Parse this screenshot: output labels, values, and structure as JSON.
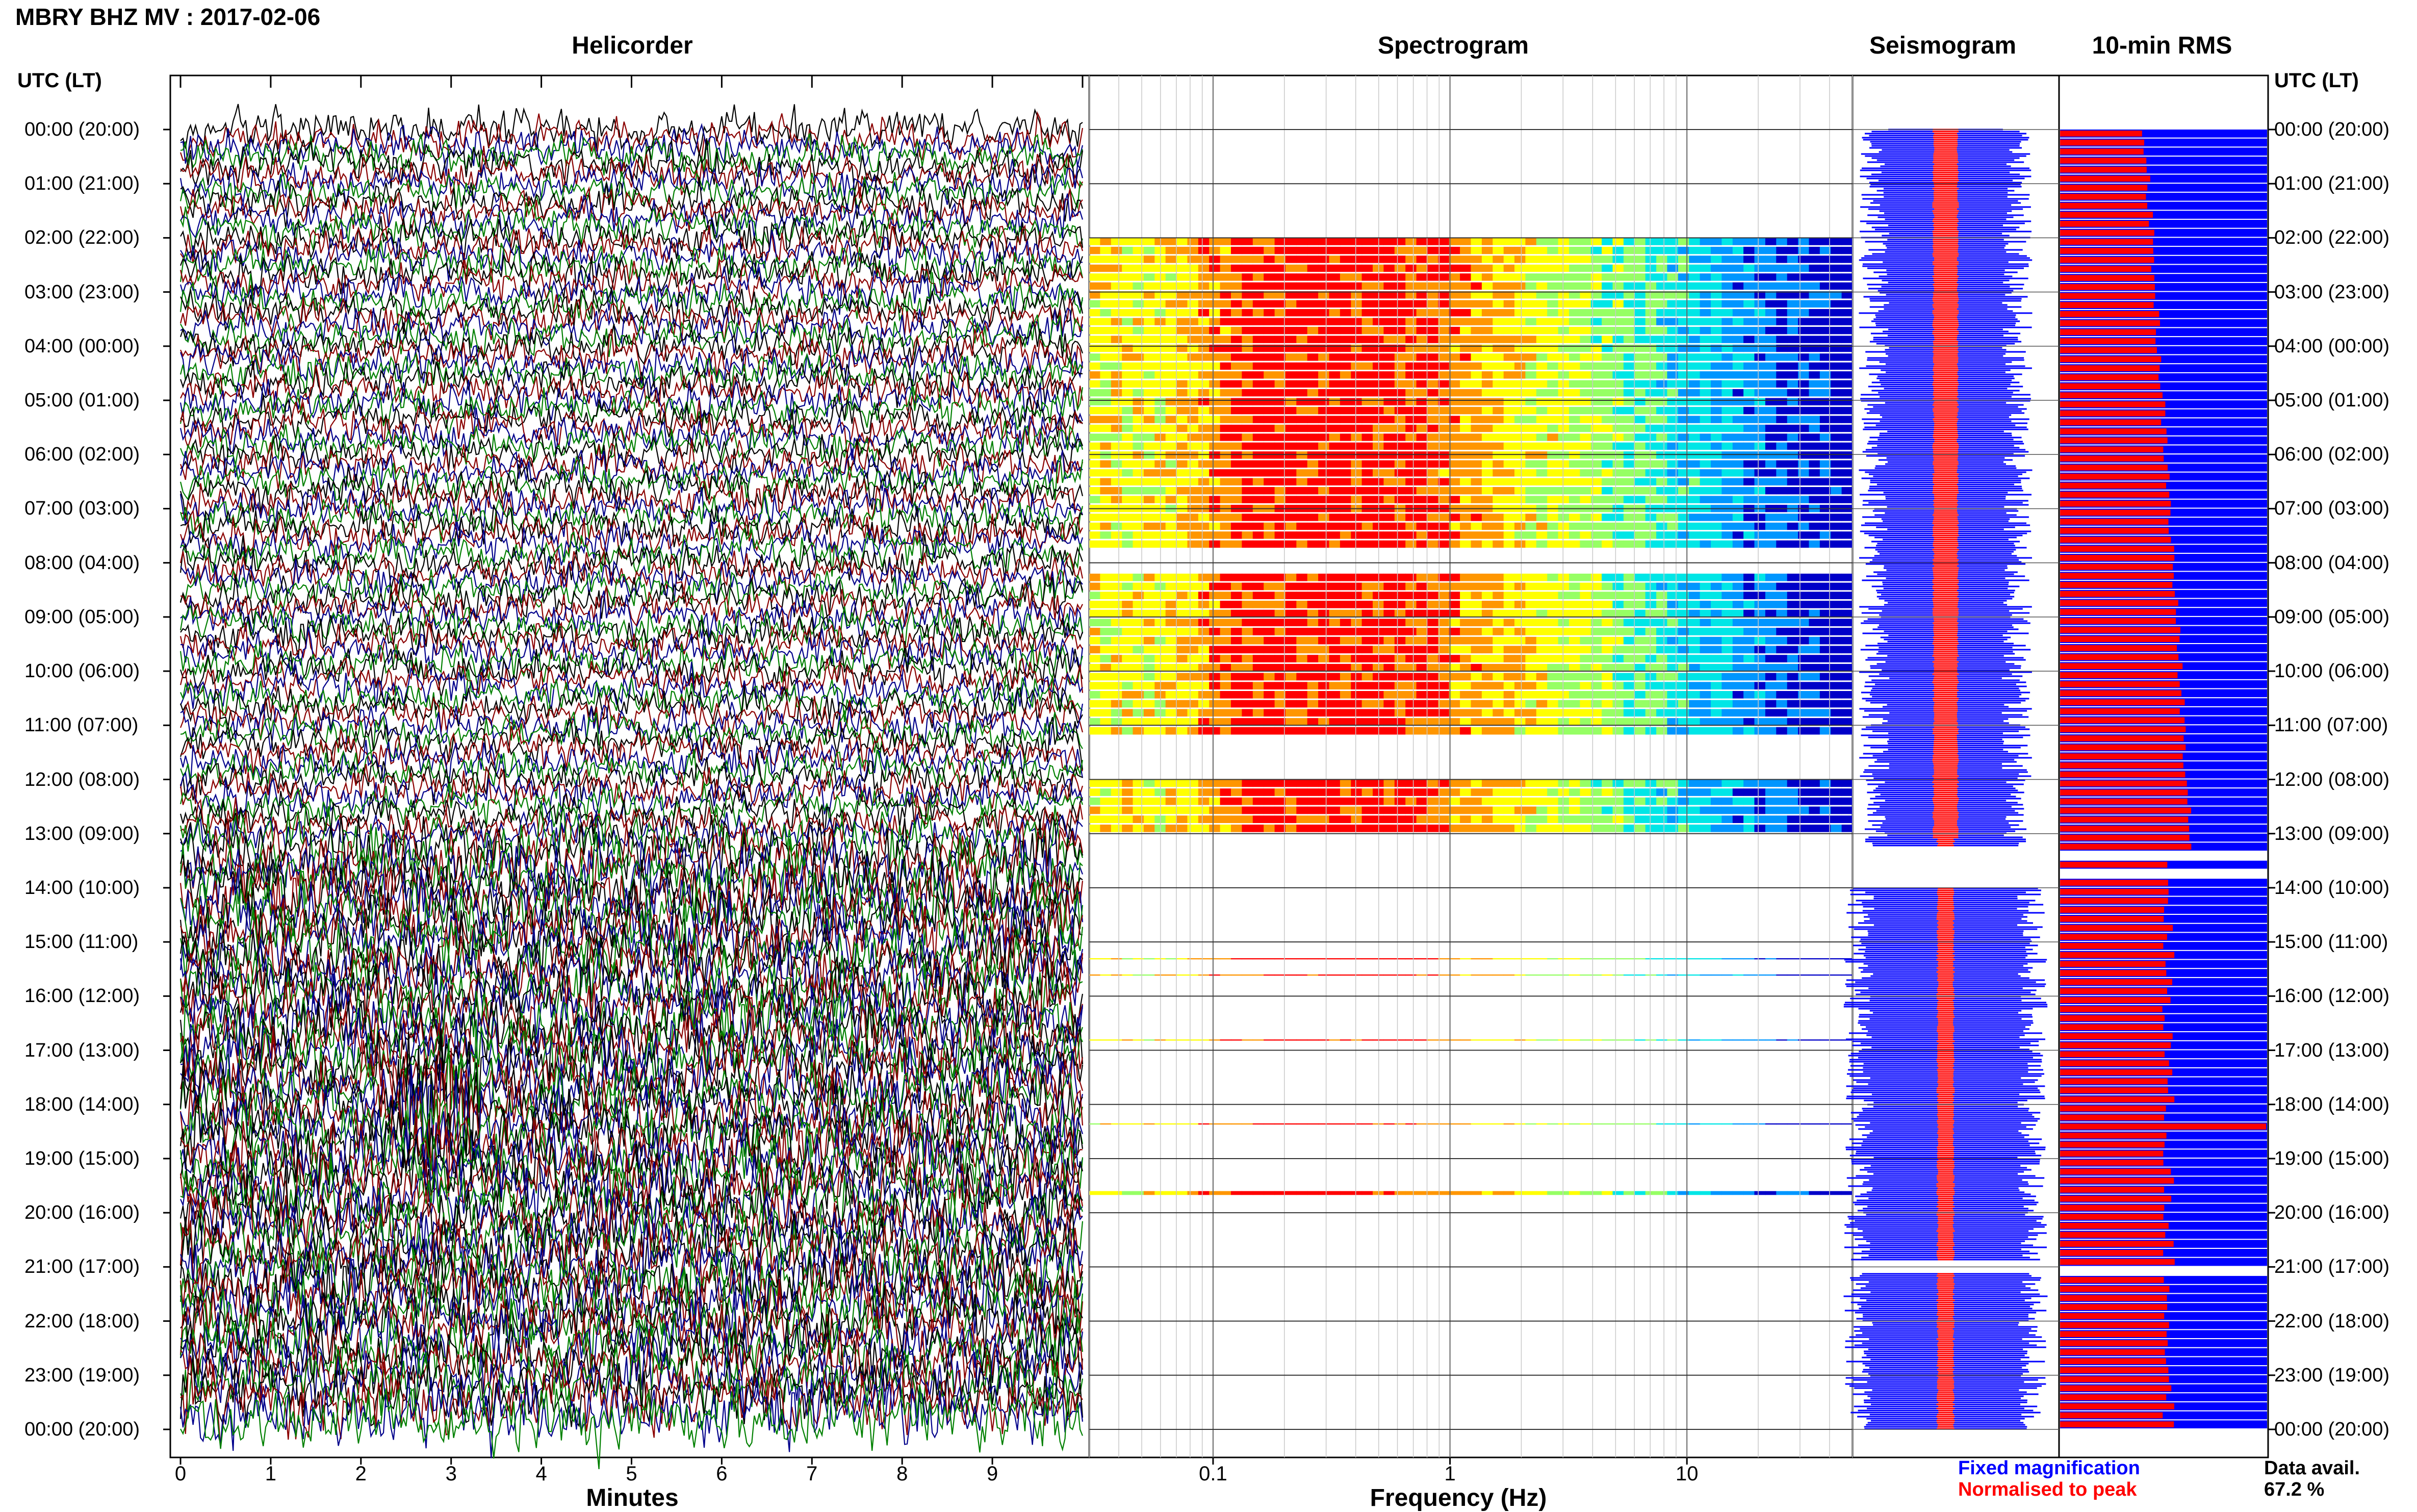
{
  "header": {
    "station": "MBRY BHZ MV : 2017-02-06"
  },
  "panels": {
    "helicorder": "Helicorder",
    "spectrogram": "Spectrogram",
    "seismogram": "Seismogram",
    "rms": "10-min RMS"
  },
  "time_axis": {
    "label_left": "UTC (LT)",
    "label_right": "UTC (LT)",
    "hours": [
      "00:00 (20:00)",
      "01:00 (21:00)",
      "02:00 (22:00)",
      "03:00 (23:00)",
      "04:00 (00:00)",
      "05:00 (01:00)",
      "06:00 (02:00)",
      "07:00 (03:00)",
      "08:00 (04:00)",
      "09:00 (05:00)",
      "10:00 (06:00)",
      "11:00 (07:00)",
      "12:00 (08:00)",
      "13:00 (09:00)",
      "14:00 (10:00)",
      "15:00 (11:00)",
      "16:00 (12:00)",
      "17:00 (13:00)",
      "18:00 (14:00)",
      "19:00 (15:00)",
      "20:00 (16:00)",
      "21:00 (17:00)",
      "22:00 (18:00)",
      "23:00 (19:00)",
      "00:00 (20:00)"
    ]
  },
  "footer": {
    "minutes_label": "Minutes",
    "frequency_label": "Frequency (Hz)",
    "minute_ticks": [
      "0",
      "1",
      "2",
      "3",
      "4",
      "5",
      "6",
      "7",
      "8",
      "9"
    ],
    "frequency_ticks": [
      "0.1",
      "1",
      "10"
    ],
    "legend_fixed": "Fixed magnification",
    "legend_norm": "Normalised to peak",
    "avail_label": "Data avail.",
    "avail_value": "67.2 %"
  },
  "colors": {
    "trace_cycle": [
      "#000000",
      "#8b0000",
      "#00008b",
      "#008000"
    ],
    "fixed": "#0000ff",
    "normalised": "#ff0000",
    "spectrogram_scale": [
      "#0000c8",
      "#0096ff",
      "#00e6e6",
      "#96ff64",
      "#ffff00",
      "#ff9600",
      "#ff0000"
    ]
  },
  "chart_data": {
    "type": "seismic-daily-summary",
    "minutes_range": [
      0,
      10
    ],
    "frequency_range_hz": [
      0.03,
      50
    ],
    "frequency_scale": "log",
    "hours_utc": [
      0,
      24
    ],
    "rms_interval_min": 10,
    "data_availability_percent": 67.2,
    "spectrogram_blocks_hours": [
      [
        2.0,
        7.75
      ],
      [
        8.2,
        11.2
      ],
      [
        12.0,
        13.0
      ],
      [
        15.3,
        15.35
      ],
      [
        15.6,
        15.65
      ],
      [
        16.8,
        16.85
      ],
      [
        18.35,
        18.4
      ],
      [
        19.6,
        19.7
      ]
    ],
    "seismogram_gaps_hours": [
      [
        13.25,
        14.0
      ],
      [
        20.9,
        21.1
      ]
    ],
    "rms_gaps_hours": [
      [
        13.3,
        13.45
      ],
      [
        13.6,
        13.75
      ],
      [
        20.95,
        21.1
      ]
    ],
    "rms_spike_hours": [
      18.4
    ]
  }
}
